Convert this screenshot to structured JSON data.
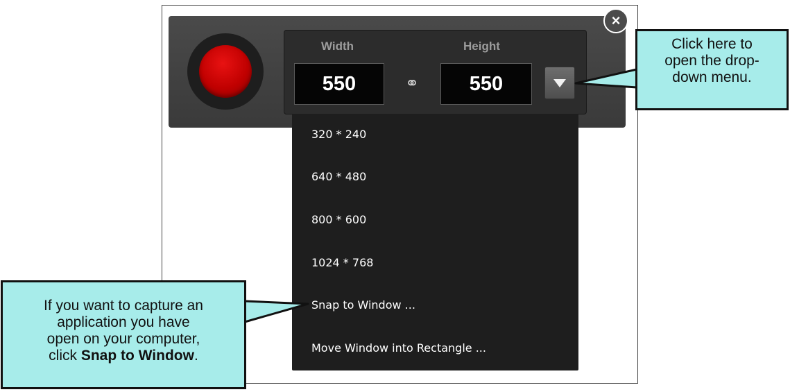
{
  "toolbar": {
    "width_label": "Width",
    "height_label": "Height",
    "width_value": "550",
    "height_value": "550",
    "close_glyph": "×",
    "link_glyph": "⚭"
  },
  "menu": {
    "items": [
      "320 * 240",
      "640 * 480",
      "800 * 600",
      "1024 * 768",
      "Snap to Window ...",
      "Move Window into Rectangle ..."
    ]
  },
  "callouts": {
    "dropdown": {
      "line1": "Click here to",
      "line2": "open the drop-",
      "line3": "down menu."
    },
    "snap": {
      "line1": "If you want to capture an",
      "line2": "application you have",
      "line3": "open on your computer,",
      "line4_prefix": "click ",
      "line4_bold": "Snap to Window",
      "line4_suffix": "."
    }
  },
  "colors": {
    "record": "#c00000",
    "callout_fill": "#a7ecea",
    "menu_bg": "#1e1e1e"
  },
  "icons": [
    "record-icon",
    "link-icon",
    "chevron-down-icon",
    "close-icon"
  ]
}
